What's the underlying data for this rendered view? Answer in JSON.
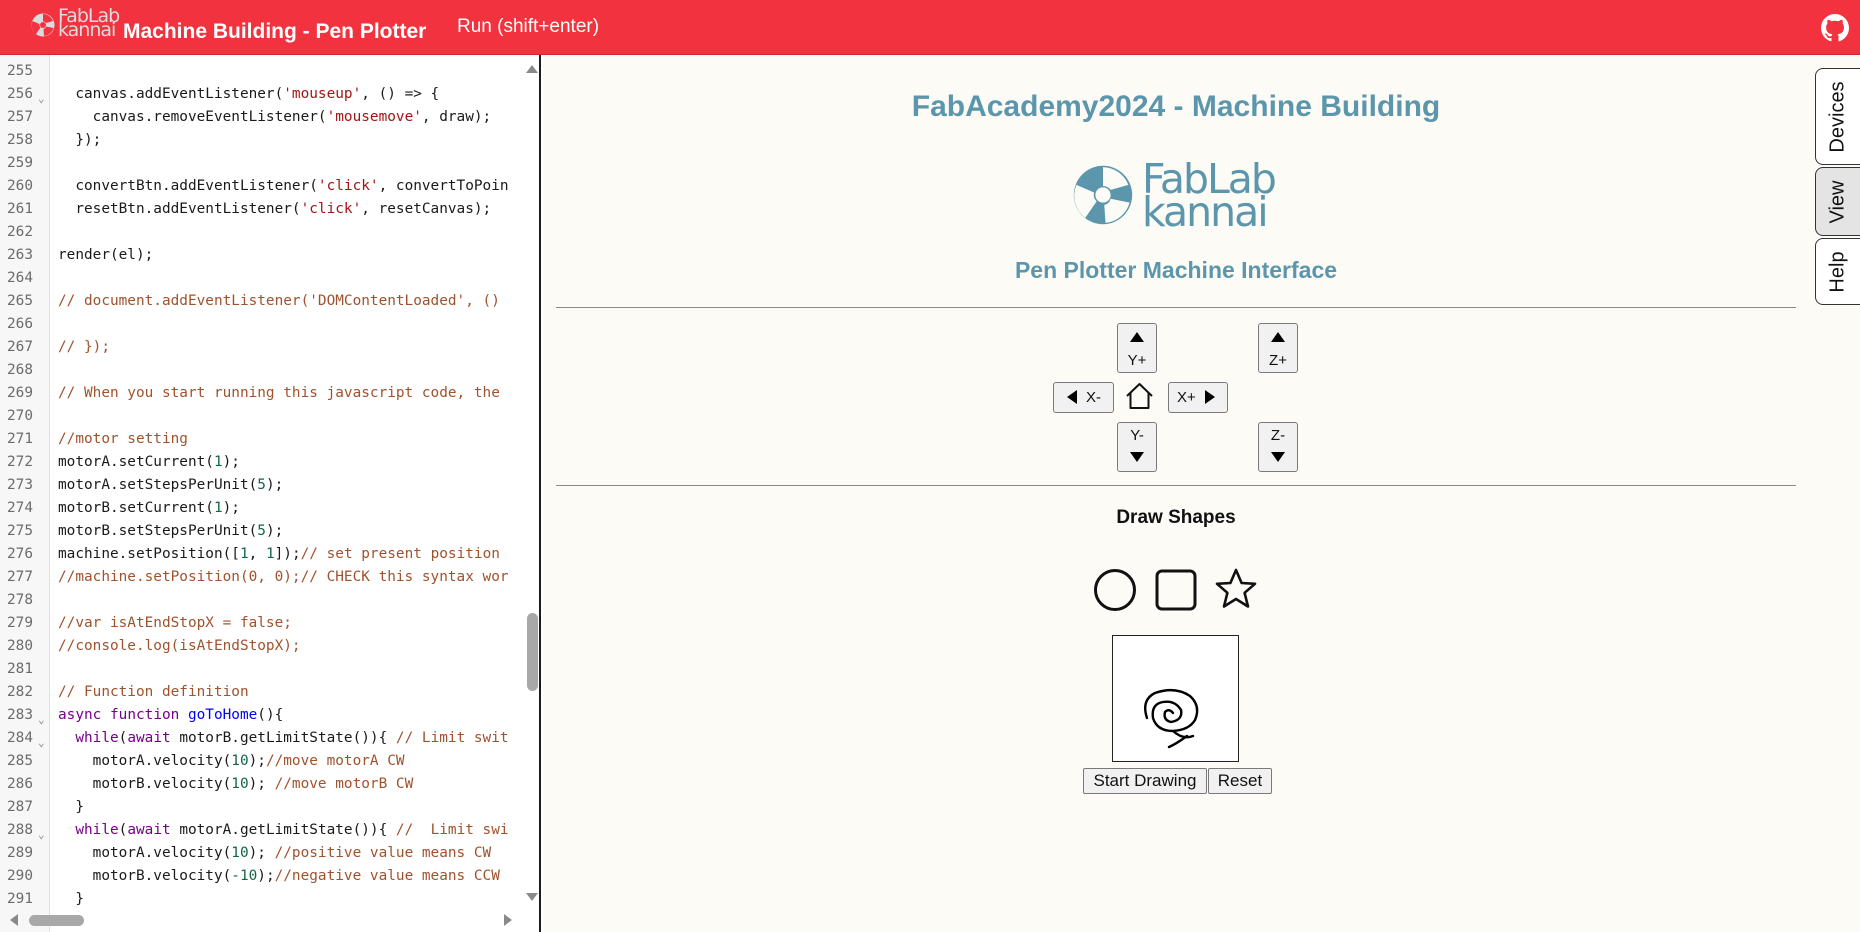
{
  "header": {
    "logo_text_top": "FabLab",
    "logo_text_bottom": "kannai",
    "title": "Machine Building - Pen Plotter",
    "run_label": "Run (shift+enter)",
    "github_icon": "github-icon",
    "bg_color": "#f2333f"
  },
  "editor": {
    "lines": [
      {
        "n": "255",
        "fold": false,
        "html": ""
      },
      {
        "n": "256",
        "fold": true,
        "html": "  canvas.addEventListener(<span class='t-str'>'mouseup'</span>, () => {"
      },
      {
        "n": "257",
        "fold": false,
        "html": "    canvas.removeEventListener(<span class='t-str'>'mousemove'</span>, draw);"
      },
      {
        "n": "258",
        "fold": false,
        "html": "  });"
      },
      {
        "n": "259",
        "fold": false,
        "html": ""
      },
      {
        "n": "260",
        "fold": false,
        "html": "  convertBtn.addEventListener(<span class='t-str'>'click'</span>, convertToPoin"
      },
      {
        "n": "261",
        "fold": false,
        "html": "  resetBtn.addEventListener(<span class='t-str'>'click'</span>, resetCanvas);"
      },
      {
        "n": "262",
        "fold": false,
        "html": ""
      },
      {
        "n": "263",
        "fold": false,
        "html": "render(el);"
      },
      {
        "n": "264",
        "fold": false,
        "html": ""
      },
      {
        "n": "265",
        "fold": false,
        "html": "<span class='t-com'>// document.addEventListener('DOMContentLoaded', ()</span>"
      },
      {
        "n": "266",
        "fold": false,
        "html": ""
      },
      {
        "n": "267",
        "fold": false,
        "html": "<span class='t-com'>// });</span>"
      },
      {
        "n": "268",
        "fold": false,
        "html": ""
      },
      {
        "n": "269",
        "fold": false,
        "html": "<span class='t-com'>// When you start running this javascript code, the</span>"
      },
      {
        "n": "270",
        "fold": false,
        "html": ""
      },
      {
        "n": "271",
        "fold": false,
        "html": "<span class='t-com'>//motor setting</span>"
      },
      {
        "n": "272",
        "fold": false,
        "html": "motorA.setCurrent(<span class='t-num'>1</span>);"
      },
      {
        "n": "273",
        "fold": false,
        "html": "motorA.setStepsPerUnit(<span class='t-num'>5</span>);"
      },
      {
        "n": "274",
        "fold": false,
        "html": "motorB.setCurrent(<span class='t-num'>1</span>);"
      },
      {
        "n": "275",
        "fold": false,
        "html": "motorB.setStepsPerUnit(<span class='t-num'>5</span>);"
      },
      {
        "n": "276",
        "fold": false,
        "html": "machine.setPosition([<span class='t-num'>1</span>, <span class='t-num'>1</span>]);<span class='t-com'>// set present position</span>"
      },
      {
        "n": "277",
        "fold": false,
        "html": "<span class='t-com'>//machine.setPosition(0, 0);// CHECK this syntax wor</span>"
      },
      {
        "n": "278",
        "fold": false,
        "html": ""
      },
      {
        "n": "279",
        "fold": false,
        "html": "<span class='t-com'>//var isAtEndStopX = false;</span>"
      },
      {
        "n": "280",
        "fold": false,
        "html": "<span class='t-com'>//console.log(isAtEndStopX);</span>"
      },
      {
        "n": "281",
        "fold": false,
        "html": ""
      },
      {
        "n": "282",
        "fold": false,
        "html": "<span class='t-com'>// Function definition</span>"
      },
      {
        "n": "283",
        "fold": true,
        "html": "<span class='t-kw'>async</span> <span class='t-kw'>function</span> <span class='t-def'>goToHome</span>(){"
      },
      {
        "n": "284",
        "fold": true,
        "html": "  <span class='t-kw'>while</span>(<span class='t-kw'>await</span> motorB.getLimitState()){ <span class='t-com'>// Limit swit</span>"
      },
      {
        "n": "285",
        "fold": false,
        "html": "    motorA.velocity(<span class='t-num'>10</span>);<span class='t-com'>//move motorA CW</span>"
      },
      {
        "n": "286",
        "fold": false,
        "html": "    motorB.velocity(<span class='t-num'>10</span>); <span class='t-com'>//move motorB CW</span>"
      },
      {
        "n": "287",
        "fold": false,
        "html": "  }"
      },
      {
        "n": "288",
        "fold": true,
        "html": "  <span class='t-kw'>while</span>(<span class='t-kw'>await</span> motorA.getLimitState()){ <span class='t-com'>//  Limit swi</span>"
      },
      {
        "n": "289",
        "fold": false,
        "html": "    motorA.velocity(<span class='t-num'>10</span>); <span class='t-com'>//positive value means CW</span>"
      },
      {
        "n": "290",
        "fold": false,
        "html": "    motorB.velocity(<span class='t-num'>-10</span>);<span class='t-com'>//negative value means CCW</span>"
      },
      {
        "n": "291",
        "fold": false,
        "html": "  }"
      }
    ]
  },
  "panel": {
    "title": "FabAcademy2024 - Machine Building",
    "logo_text_top": "FabLab",
    "logo_text_bottom": "kannai",
    "subtitle": "Pen Plotter Machine Interface",
    "jog": {
      "y_plus": "Y+",
      "y_minus": "Y-",
      "x_minus": "X-",
      "x_plus": "X+",
      "z_plus": "Z+",
      "z_minus": "Z-",
      "home_icon": "home-icon"
    },
    "draw_title": "Draw Shapes",
    "shapes": [
      "circle-icon",
      "square-icon",
      "star-icon"
    ],
    "start_drawing": "Start Drawing",
    "reset": "Reset",
    "accent_color": "#5b96ac"
  },
  "side_tabs": [
    {
      "label": "Devices",
      "active": false
    },
    {
      "label": "View",
      "active": true
    },
    {
      "label": "Help",
      "active": false
    }
  ]
}
